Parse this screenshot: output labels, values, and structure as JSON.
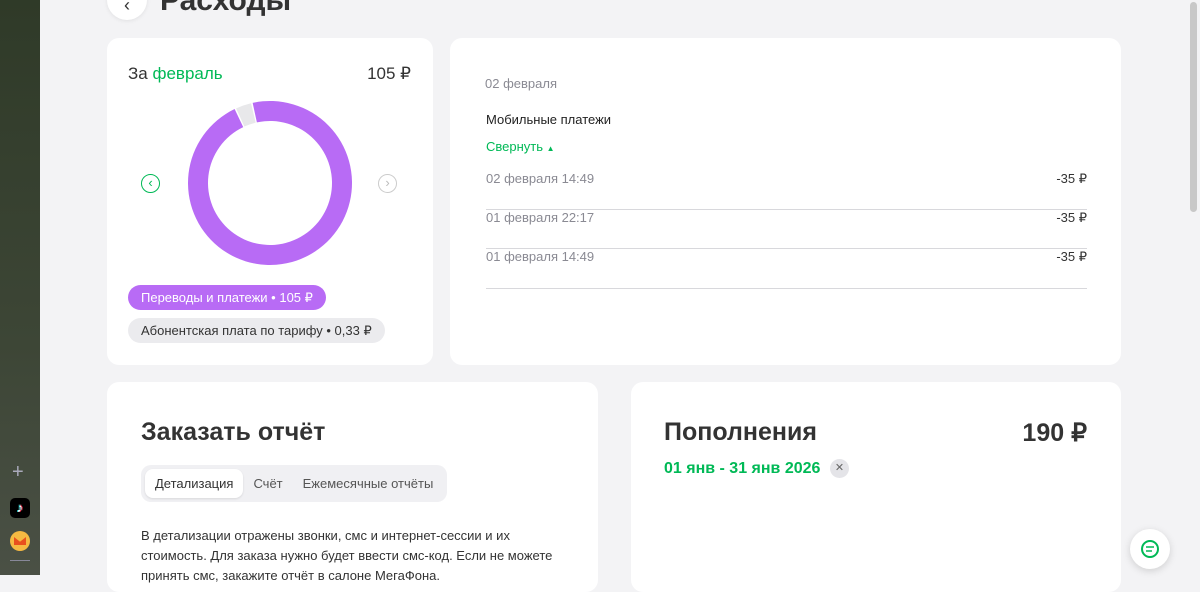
{
  "page": {
    "title": "Расходы"
  },
  "expenses": {
    "prefix": "За",
    "month": "февраль",
    "total": "105 ₽",
    "chart_data": {
      "type": "pie",
      "title": "За февраль",
      "values": [
        105,
        0.33
      ],
      "labels": [
        "Переводы и платежи",
        "Абонентская плата по тарифу"
      ],
      "colors": [
        "#b86bf5",
        "#e8e8ea"
      ]
    },
    "legend": [
      "Переводы и платежи • 105 ₽",
      "Абонентская плата по тарифу • 0,33 ₽"
    ]
  },
  "details": {
    "date": "02 февраля",
    "category": "Мобильные платежи",
    "collapse": "Свернуть",
    "rows": [
      {
        "time": "02 февраля 14:49",
        "amount": "-35 ₽"
      },
      {
        "time": "01 февраля 22:17",
        "amount": "-35 ₽"
      },
      {
        "time": "01 февраля 14:49",
        "amount": "-35 ₽"
      }
    ]
  },
  "report": {
    "title": "Заказать отчёт",
    "tabs": [
      "Детализация",
      "Счёт",
      "Ежемесячные отчёты"
    ],
    "text": "В детализации отражены звонки, смс и интернет-сессии и их стоимость. Для заказа нужно будет ввести смс-код. Если не можете принять смс, закажите отчёт в салоне МегаФона."
  },
  "topups": {
    "title": "Пополнения",
    "total": "190 ₽",
    "period": "01 янв - 31 янв 2026"
  }
}
